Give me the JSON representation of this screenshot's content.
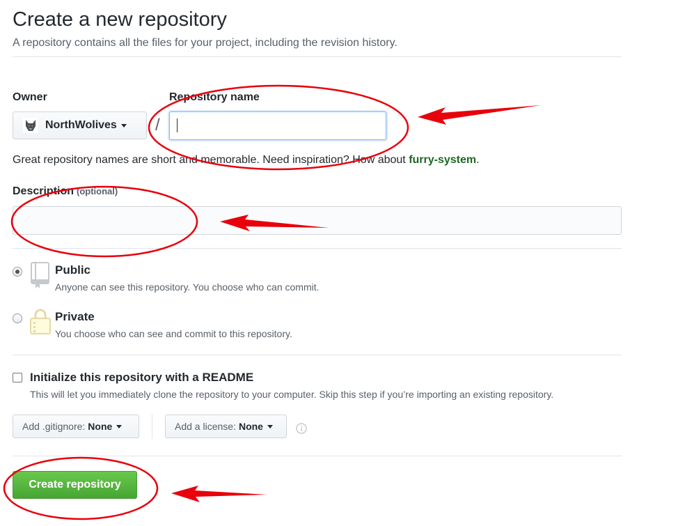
{
  "header": {
    "title": "Create a new repository",
    "subtitle": "A repository contains all the files for your project, including the revision history."
  },
  "owner": {
    "label": "Owner",
    "value": "NorthWolives"
  },
  "repository": {
    "label": "Repository name",
    "separator": "/",
    "value": "",
    "hint_prefix": "Great repository names are short and memorable. Need inspiration? How about ",
    "suggestion": "furry-system",
    "hint_suffix": "."
  },
  "description": {
    "label": "Description",
    "optional": "(optional)",
    "value": ""
  },
  "visibility": {
    "public": {
      "title": "Public",
      "description": "Anyone can see this repository. You choose who can commit.",
      "checked": true
    },
    "private": {
      "title": "Private",
      "description": "You choose who can see and commit to this repository.",
      "checked": false
    }
  },
  "readme": {
    "title": "Initialize this repository with a README",
    "description": "This will let you immediately clone the repository to your computer. Skip this step if you’re importing an existing repository.",
    "checked": false
  },
  "gitignore": {
    "label": "Add .gitignore:",
    "value": "None"
  },
  "license": {
    "label": "Add a license:",
    "value": "None"
  },
  "icons": {
    "owner_avatar": "wolf-avatar-icon",
    "public": "repo-book-icon",
    "private": "lock-icon",
    "info": "info-icon"
  },
  "submit": {
    "label": "Create repository"
  },
  "colors": {
    "accent_green": "#28a745",
    "annotation_red": "#e8000b",
    "suggestion_green": "#1e6823"
  }
}
